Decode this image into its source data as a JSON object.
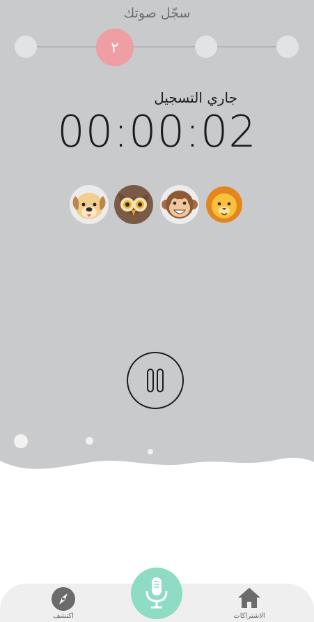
{
  "header": {
    "title": "سجّل صوتك"
  },
  "stepper": {
    "active_step_label": "٢",
    "total_steps": 4,
    "active_step": 2
  },
  "recording": {
    "status_label": "جاري التسجيل",
    "elapsed": "00:00:02"
  },
  "animals": [
    {
      "name": "dog",
      "icon": "dog-face-icon"
    },
    {
      "name": "owl",
      "icon": "owl-face-icon"
    },
    {
      "name": "monkey",
      "icon": "monkey-face-icon"
    },
    {
      "name": "lion",
      "icon": "lion-face-icon"
    }
  ],
  "controls": {
    "pause_icon": "pause-icon"
  },
  "bottom_nav": {
    "explore_label": "اكتشف",
    "subscriptions_label": "الاشتراكات",
    "record_icon": "microphone-icon"
  },
  "colors": {
    "background_top": "#c9cacc",
    "active_step": "#ef9ea4",
    "mic_button": "#8ddcc3",
    "nav_bar": "#efefef"
  }
}
